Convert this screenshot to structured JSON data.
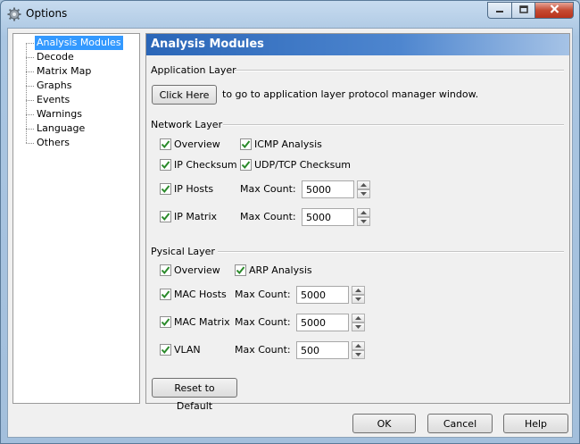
{
  "window": {
    "title": "Options",
    "icon": "gear-icon"
  },
  "tree": {
    "items": [
      {
        "label": "Analysis Modules",
        "selected": true
      },
      {
        "label": "Decode"
      },
      {
        "label": "Matrix Map"
      },
      {
        "label": "Graphs"
      },
      {
        "label": "Events"
      },
      {
        "label": "Warnings"
      },
      {
        "label": "Language"
      },
      {
        "label": "Others"
      }
    ]
  },
  "panel": {
    "header": "Analysis Modules",
    "application_layer": {
      "title": "Application Layer",
      "button_label": "Click Here",
      "button_hint": "to go to application layer protocol manager window."
    },
    "network_layer": {
      "title": "Network Layer",
      "overview": {
        "label": "Overview",
        "checked": true
      },
      "icmp": {
        "label": "ICMP Analysis",
        "checked": true
      },
      "ip_checksum": {
        "label": "IP Checksum",
        "checked": true
      },
      "udp_tcp": {
        "label": "UDP/TCP Checksum",
        "checked": true
      },
      "ip_hosts": {
        "label": "IP Hosts",
        "checked": true,
        "max_label": "Max Count:",
        "max_value": "5000"
      },
      "ip_matrix": {
        "label": "IP Matrix",
        "checked": true,
        "max_label": "Max Count:",
        "max_value": "5000"
      }
    },
    "physical_layer": {
      "title": "Pysical Layer",
      "overview": {
        "label": "Overview",
        "checked": true
      },
      "arp": {
        "label": "ARP Analysis",
        "checked": true
      },
      "mac_hosts": {
        "label": "MAC Hosts",
        "checked": true,
        "max_label": "Max Count:",
        "max_value": "5000"
      },
      "mac_matrix": {
        "label": "MAC Matrix",
        "checked": true,
        "max_label": "Max Count:",
        "max_value": "5000"
      },
      "vlan": {
        "label": "VLAN",
        "checked": true,
        "max_label": "Max Count:",
        "max_value": "500"
      }
    },
    "reset_label": "Reset to Default"
  },
  "footer": {
    "ok": "OK",
    "cancel": "Cancel",
    "help": "Help"
  },
  "colors": {
    "accent": "#3399ff",
    "header": "#2a66b8",
    "check": "#2a8a2a"
  }
}
